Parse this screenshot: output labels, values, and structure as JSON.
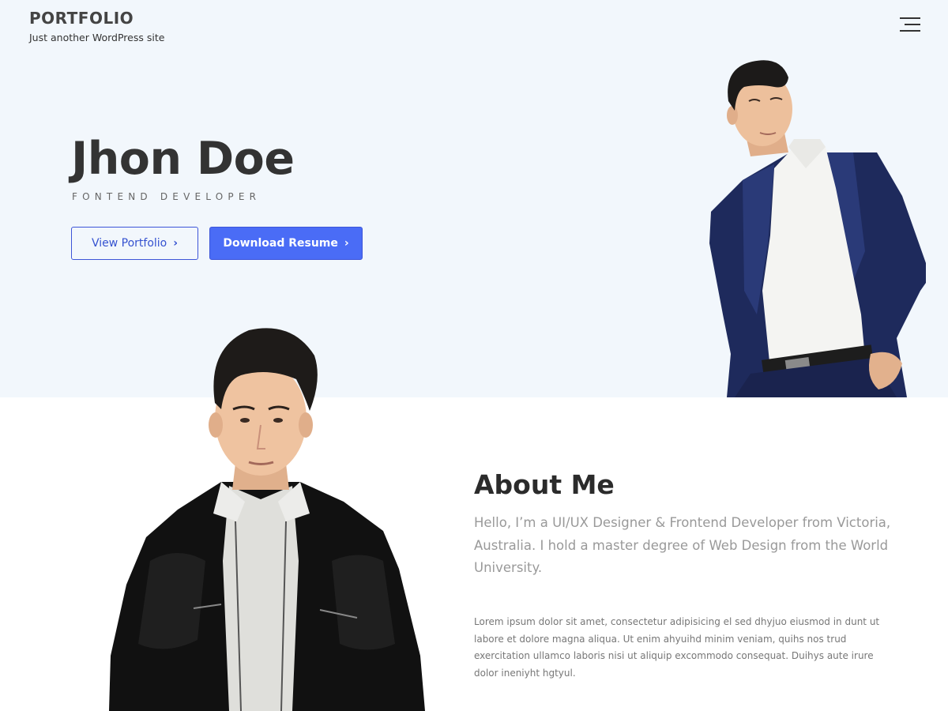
{
  "header": {
    "site_title": "PORTFOLIO",
    "tagline": "Just another WordPress site",
    "menu_icon": "hamburger-menu-icon"
  },
  "hero": {
    "name": "Jhon Doe",
    "role": "FONTEND DEVELOPER",
    "buttons": {
      "view_portfolio": "View Portfolio",
      "download_resume": "Download Resume",
      "chevron": "›"
    },
    "colors": {
      "background": "#f2f7fc",
      "accent": "#4a6cf6"
    }
  },
  "about": {
    "title": "About Me",
    "lead": "Hello, I’m a UI/UX Designer & Frontend Developer from Victoria, Australia. I hold a master degree of Web Design from the World University.",
    "body": "Lorem ipsum dolor sit amet, consectetur adipisicing el sed dhyjuo eiusmod in dunt ut labore et dolore magna aliqua. Ut enim ahyuihd minim veniam, quihs nos trud exercitation ullamco laboris nisi ut aliquip excommodo consequat. Duihys aute irure dolor ineniyht hgtyul."
  }
}
